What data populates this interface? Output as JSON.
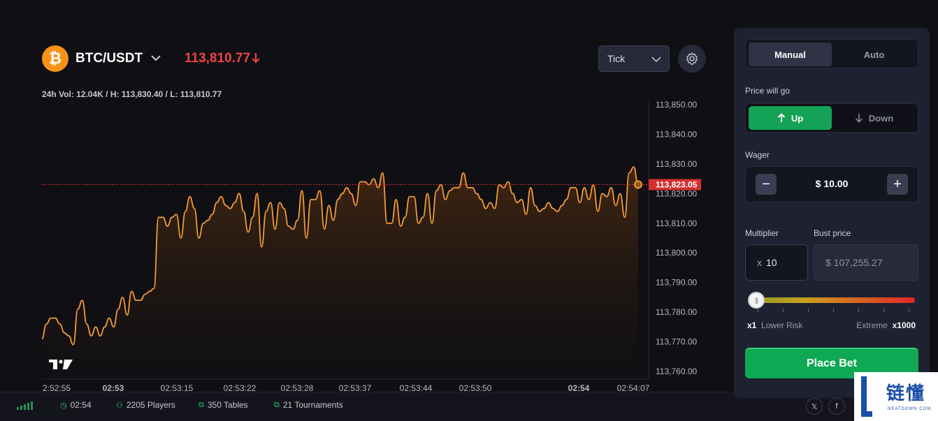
{
  "header": {
    "pair_logo": "₿",
    "pair": "BTC/USDT",
    "price": "113,810.77",
    "stats": "24h Vol: 12.04K / H: 113,830.40 / L: 113,810.77",
    "interval": "Tick"
  },
  "chart_data": {
    "type": "area",
    "series": [
      {
        "values": [
          113771,
          113776,
          113778,
          113778,
          113776,
          113773,
          113772,
          113769,
          113781,
          113784,
          113776,
          113772,
          113775,
          113772,
          113775,
          113778,
          113775,
          113781,
          113785,
          113779,
          113787,
          113784,
          113784,
          113786,
          113787,
          113788,
          113812,
          113812,
          113809,
          113812,
          113813,
          113805,
          113814,
          113819,
          113815,
          113805,
          113810,
          113811,
          113813,
          113817,
          113819,
          113816,
          113815,
          113817,
          113820,
          113814,
          113807,
          113812,
          113820,
          113802,
          113814,
          113817,
          113808,
          113817,
          113815,
          113809,
          113808,
          113811,
          113821,
          113805,
          113818,
          113818,
          113821,
          113808,
          113816,
          113811,
          113818,
          113820,
          113822,
          113820,
          113816,
          113824,
          113824,
          113823,
          113825,
          113822,
          113827,
          113810,
          113810,
          113818,
          113809,
          113812,
          113819,
          113819,
          113810,
          113812,
          113820,
          113810,
          113821,
          113823,
          113818,
          113821,
          113822,
          113822,
          113827,
          113822,
          113822,
          113820,
          113818,
          113815,
          113817,
          113815,
          113823,
          113822,
          113824,
          113820,
          113817,
          113818,
          113813,
          113822,
          113816,
          113814,
          113815,
          113817,
          113815,
          113814,
          113816,
          113818,
          113822,
          113822,
          113817,
          113822,
          113818,
          113823,
          113814,
          113820,
          113819,
          113822,
          113816,
          113820,
          113812,
          113827,
          113829,
          113823
        ]
      }
    ],
    "y_ticks": [
      "113,850.00",
      "113,840.00",
      "113,830.00",
      "113,820.00",
      "113,810.00",
      "113,800.00",
      "113,790.00",
      "113,780.00",
      "113,770.00",
      "113,760.00"
    ],
    "ylim": [
      113760,
      113850
    ],
    "x_ticks": [
      "2:52:55",
      "02:53",
      "02:53:15",
      "02:53:22",
      "02:53:28",
      "02:53:37",
      "02:53:44",
      "02:53:50",
      "02:54",
      "02:54:07"
    ],
    "current_price_label": "113,823.05",
    "current_price": 113823.05,
    "line_color": "#f59a35",
    "price_line_color": "#e53935"
  },
  "status": {
    "time": "02:54",
    "players": "2205 Players",
    "tables": "350 Tables",
    "tournaments": "21 Tournaments"
  },
  "panel": {
    "tab_manual": "Manual",
    "tab_auto": "Auto",
    "price_label": "Price will go",
    "up_label": "Up",
    "down_label": "Down",
    "wager_label": "Wager",
    "wager_value": "$ 10.00",
    "minus": "−",
    "plus": "+",
    "multiplier_label": "Multiplier",
    "multiplier_prefix": "x",
    "multiplier_value": "10",
    "bust_label": "Bust price",
    "bust_value": "$ 107,255.27",
    "slider_level": 0,
    "risk_min_mult": "x1",
    "risk_min_label": "Lower Risk",
    "risk_max_label": "Extreme",
    "risk_max_mult": "x1000",
    "place_bet": "Place Bet"
  },
  "social": {
    "x": "𝕏",
    "facebook": "f"
  },
  "watermark": {
    "cn": "链懂",
    "en": "NEATDOWN.COM"
  }
}
